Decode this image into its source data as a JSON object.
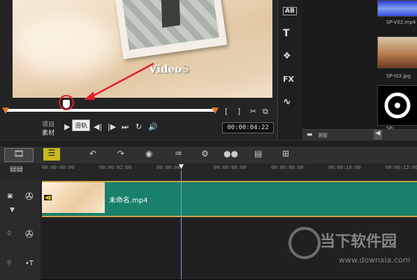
{
  "preview": {
    "title_text": "Video",
    "title_suffix": "S",
    "tooltip": "滑轨",
    "mode_project": "项目",
    "mode_clip": "素材",
    "timecode": "00:00:04:22",
    "controls": {
      "play": "▶",
      "prev": "⏮",
      "back": "◀|",
      "fwd": "|▶",
      "next": "⏭",
      "repeat": "↻",
      "volume": "🔊"
    },
    "markers": {
      "in": "[",
      "out": "]",
      "cut": "✂",
      "copy": "⧉"
    }
  },
  "side_toolbar": [
    {
      "icon": "text-ab-icon",
      "glyph": "AB"
    },
    {
      "icon": "title-icon",
      "glyph": "T"
    },
    {
      "icon": "graphic-icon",
      "glyph": "❖"
    },
    {
      "icon": "fx-icon",
      "glyph": "FX"
    },
    {
      "icon": "path-icon",
      "glyph": "∿"
    }
  ],
  "library": {
    "thumbs": [
      {
        "label": "SP-V02.mp4"
      },
      {
        "label": "SP-I03.jpg"
      },
      {
        "label": "SP-"
      }
    ],
    "browse_label": "浏览"
  },
  "timeline": {
    "toolbar": [
      "film-view-icon",
      "timeline-view-icon",
      "undo-icon",
      "redo-icon",
      "record-icon",
      "audio-mix-icon",
      "motion-icon",
      "subtitle-icon",
      "title-overlay-icon",
      "split-icon"
    ],
    "ruler": [
      "00:00:00:00",
      "00:00:02:00",
      "00:00:04:",
      "00:00:06:00",
      "00:00:08:00",
      "00:00:10:00",
      "00:00:12:00"
    ],
    "clip_name": "未命名.mp4"
  },
  "watermark": {
    "title": "当下软件园",
    "url": "www.downxia.com"
  }
}
